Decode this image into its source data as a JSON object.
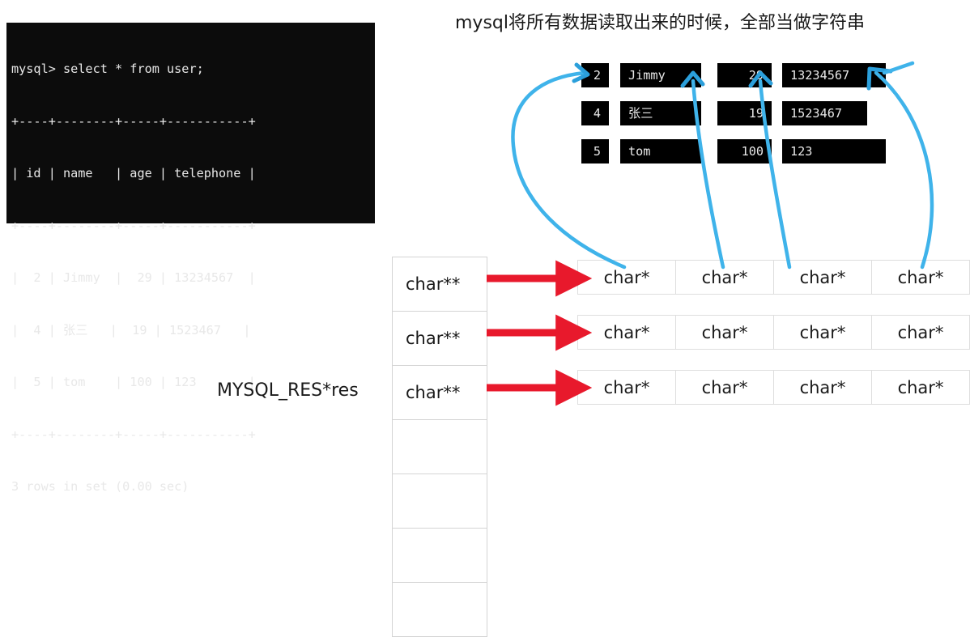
{
  "terminal": {
    "lines": [
      "mysql> select * from user;",
      "+----+--------+-----+-----------+",
      "| id | name   | age | telephone |",
      "+----+--------+-----+-----------+",
      "|  2 | Jimmy  |  29 | 13234567  |",
      "|  4 | 张三   |  19 | 1523467   |",
      "|  5 | tom    | 100 | 123       |",
      "+----+--------+-----+-----------+",
      "3 rows in set (0.00 sec)"
    ],
    "background_color": "#0c0c0c",
    "text_color": "#e8e8e8"
  },
  "heading": {
    "text": "mysql将所有数据读取出来的时候，全部当做字符串"
  },
  "data_grid": {
    "rows": [
      {
        "id": "2",
        "name": "Jimmy",
        "age": "29",
        "telephone": "13234567"
      },
      {
        "id": "4",
        "name": "张三",
        "age": "19",
        "telephone": "1523467"
      },
      {
        "id": "5",
        "name": "tom",
        "age": "100",
        "telephone": "123"
      }
    ],
    "cell_background": "#000000",
    "cell_text_color": "#e8e8e8"
  },
  "pointer_column": {
    "label": "MYSQL_RES*res",
    "cells": [
      "char**",
      "char**",
      "char**",
      "",
      "",
      "",
      ""
    ]
  },
  "pointer_rows": [
    {
      "cells": [
        "char*",
        "char*",
        "char*",
        "char*"
      ]
    },
    {
      "cells": [
        "char*",
        "char*",
        "char*",
        "char*"
      ]
    },
    {
      "cells": [
        "char*",
        "char*",
        "char*",
        "char*"
      ]
    }
  ],
  "colors": {
    "red_arrow": "#e8192c",
    "blue_arrow": "#3fb3ea",
    "table_border": "#dedede",
    "text": "#1a1a1a"
  }
}
